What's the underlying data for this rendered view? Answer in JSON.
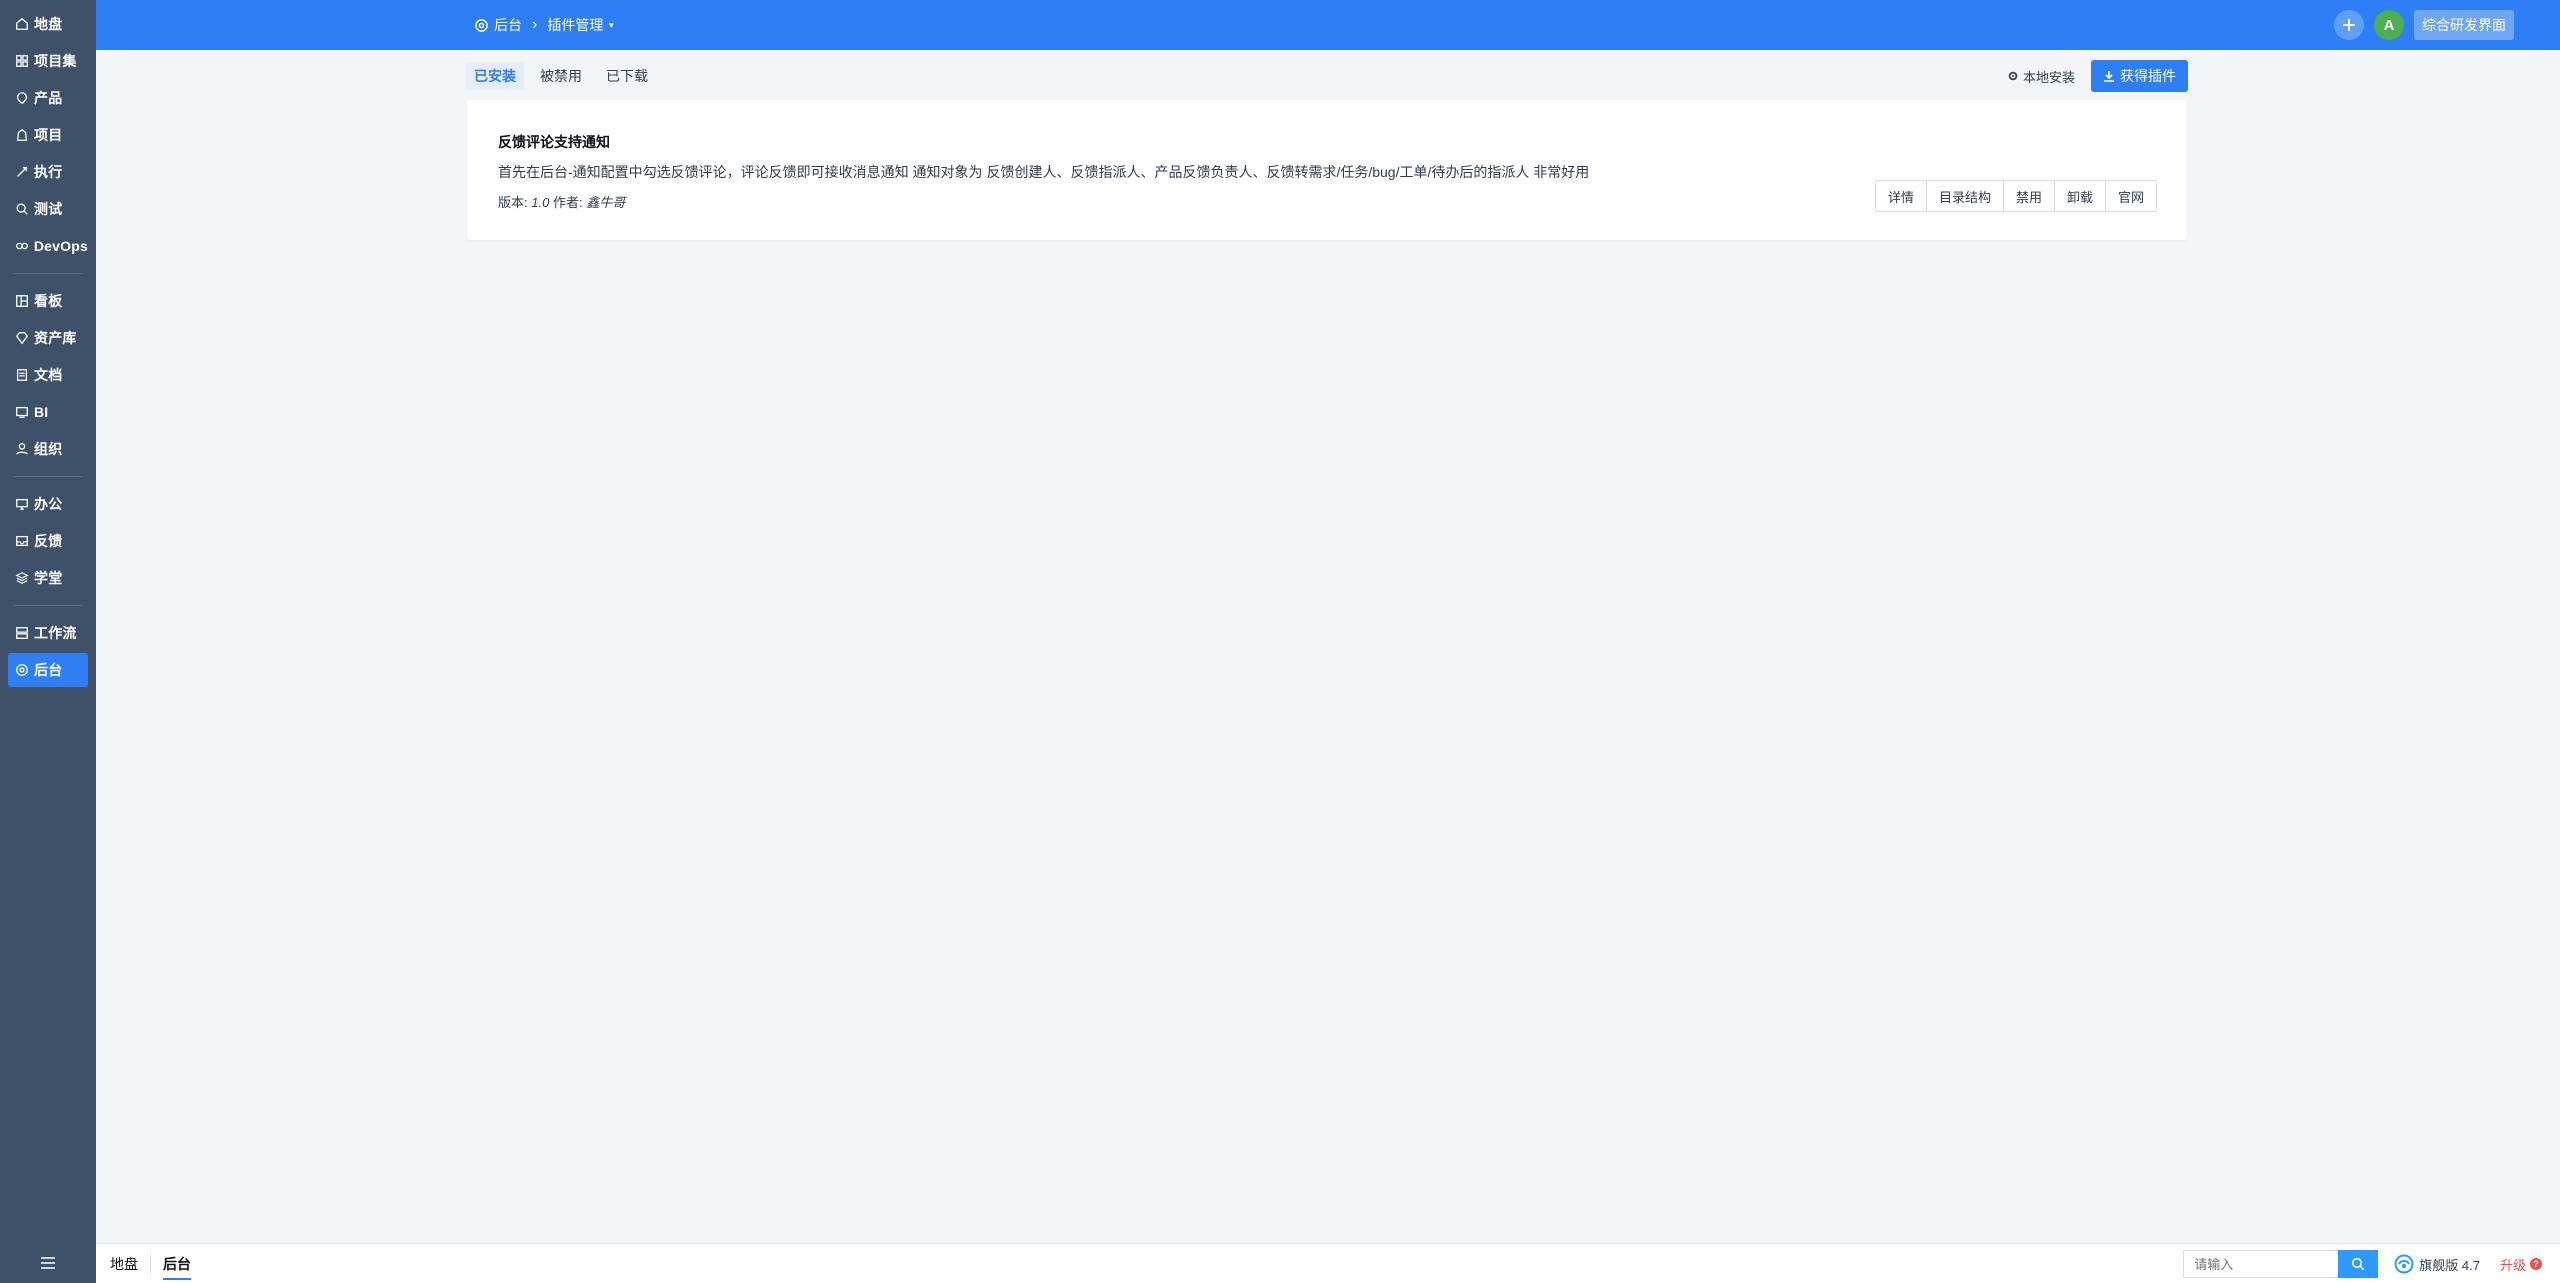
{
  "sidebar": {
    "groups": [
      [
        {
          "label": "地盘",
          "icon": "home-icon"
        },
        {
          "label": "项目集",
          "icon": "grid-icon"
        },
        {
          "label": "产品",
          "icon": "product-icon"
        },
        {
          "label": "项目",
          "icon": "project-icon"
        },
        {
          "label": "执行",
          "icon": "execution-icon"
        },
        {
          "label": "测试",
          "icon": "test-icon"
        },
        {
          "label": "DevOps",
          "icon": "devops-icon"
        }
      ],
      [
        {
          "label": "看板",
          "icon": "kanban-icon"
        },
        {
          "label": "资产库",
          "icon": "diamond-icon"
        },
        {
          "label": "文档",
          "icon": "document-icon"
        },
        {
          "label": "BI",
          "icon": "bi-icon"
        },
        {
          "label": "组织",
          "icon": "organization-icon"
        }
      ],
      [
        {
          "label": "办公",
          "icon": "office-icon"
        },
        {
          "label": "反馈",
          "icon": "feedback-icon"
        },
        {
          "label": "学堂",
          "icon": "academy-icon"
        }
      ],
      [
        {
          "label": "工作流",
          "icon": "workflow-icon"
        },
        {
          "label": "后台",
          "icon": "admin-gear-icon",
          "active": true
        }
      ]
    ],
    "toggle_icon": "menu-icon"
  },
  "header": {
    "home_label": "后台",
    "module_label": "插件管理",
    "user_initial": "A",
    "ui_switch_label": "综合研发界面",
    "accent": "#2e7ff6"
  },
  "subnav": {
    "tabs": [
      "已安装",
      "被禁用",
      "已下载"
    ],
    "active_tab": "已安装",
    "local_install": "本地安装",
    "get_plugins": "获得插件"
  },
  "plugin": {
    "title": "反馈评论支持通知",
    "description": "首先在后台-通知配置中勾选反馈评论，评论反馈即可接收消息通知 通知对象为 反馈创建人、反馈指派人、产品反馈负责人、反馈转需求/任务/bug/工单/待办后的指派人 非常好用",
    "version_label": "版本:",
    "version": "1.0",
    "author_label": "作者:",
    "author": "鑫牛哥",
    "actions": [
      "详情",
      "目录结构",
      "禁用",
      "卸载",
      "官网"
    ]
  },
  "footer": {
    "crumbs": [
      "地盘",
      "后台"
    ],
    "search_placeholder": "请输入",
    "version_text": "旗舰版 4.7",
    "upgrade_label": "升级"
  }
}
